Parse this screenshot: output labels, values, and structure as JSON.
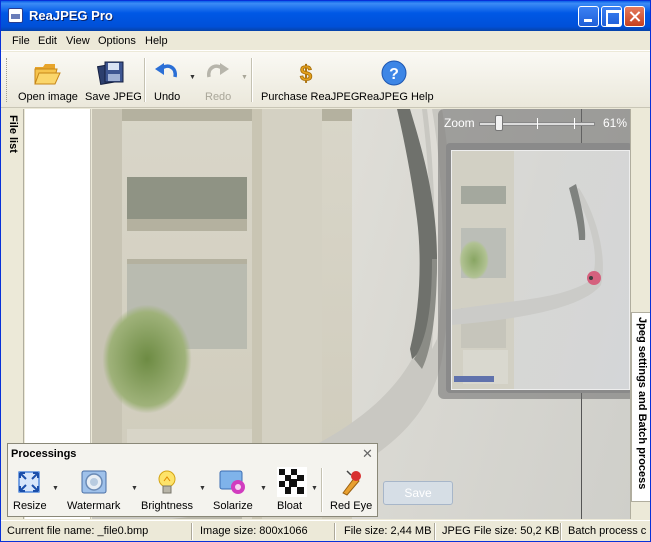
{
  "window": {
    "title": "ReaJPEG Pro"
  },
  "menu": [
    "File",
    "Edit",
    "View",
    "Options",
    "Help"
  ],
  "toolbar": {
    "open_label": "Open image",
    "save_label": "Save JPEG",
    "undo_label": "Undo",
    "redo_label": "Redo",
    "purchase_label": "Purchase ReaJPEG",
    "help_label": "ReaJPEG Help"
  },
  "side_tabs": {
    "left": "File list",
    "right": "Jpeg settings and Batch process"
  },
  "zoom": {
    "label": "Zoom",
    "value_text": "61%",
    "value": 0.61
  },
  "save_button": "Save",
  "processings": {
    "title": "Processings",
    "close": "✕",
    "tools": [
      "Resize",
      "Watermark",
      "Brightness",
      "Solarize",
      "Bloat",
      "Red Eye"
    ]
  },
  "status": {
    "current_file": "Current file name:  _file0.bmp",
    "image_size": "Image size:  800x1066",
    "file_size": "File size:  2,44 MB",
    "jpeg_size": "JPEG File size:  50,2 KB",
    "batch": "Batch process c"
  },
  "colors": {
    "titlebar": "#0058e6",
    "window_bg": "#ece9d8",
    "accent_blue": "#2b6fd6"
  },
  "icons": {
    "open": "folder-open-icon",
    "save": "floppy-save-icon",
    "undo": "undo-arrow-icon",
    "redo": "redo-arrow-icon",
    "purchase": "dollar-icon",
    "help": "question-icon"
  }
}
